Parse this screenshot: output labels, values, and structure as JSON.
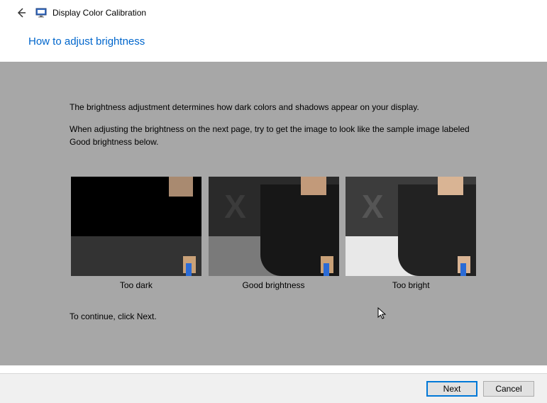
{
  "header": {
    "app_title": "Display Color Calibration",
    "back_icon": "back-arrow-icon",
    "monitor_icon": "monitor-icon"
  },
  "page": {
    "heading": "How to adjust brightness",
    "para1": "The brightness adjustment determines how dark colors and shadows appear on your display.",
    "para2": "When adjusting the brightness on the next page, try to get the image to look like the sample image labeled Good brightness below.",
    "continue": "To continue, click Next."
  },
  "samples": {
    "too_dark": "Too dark",
    "good": "Good brightness",
    "too_bright": "Too bright"
  },
  "footer": {
    "next": "Next",
    "cancel": "Cancel"
  }
}
